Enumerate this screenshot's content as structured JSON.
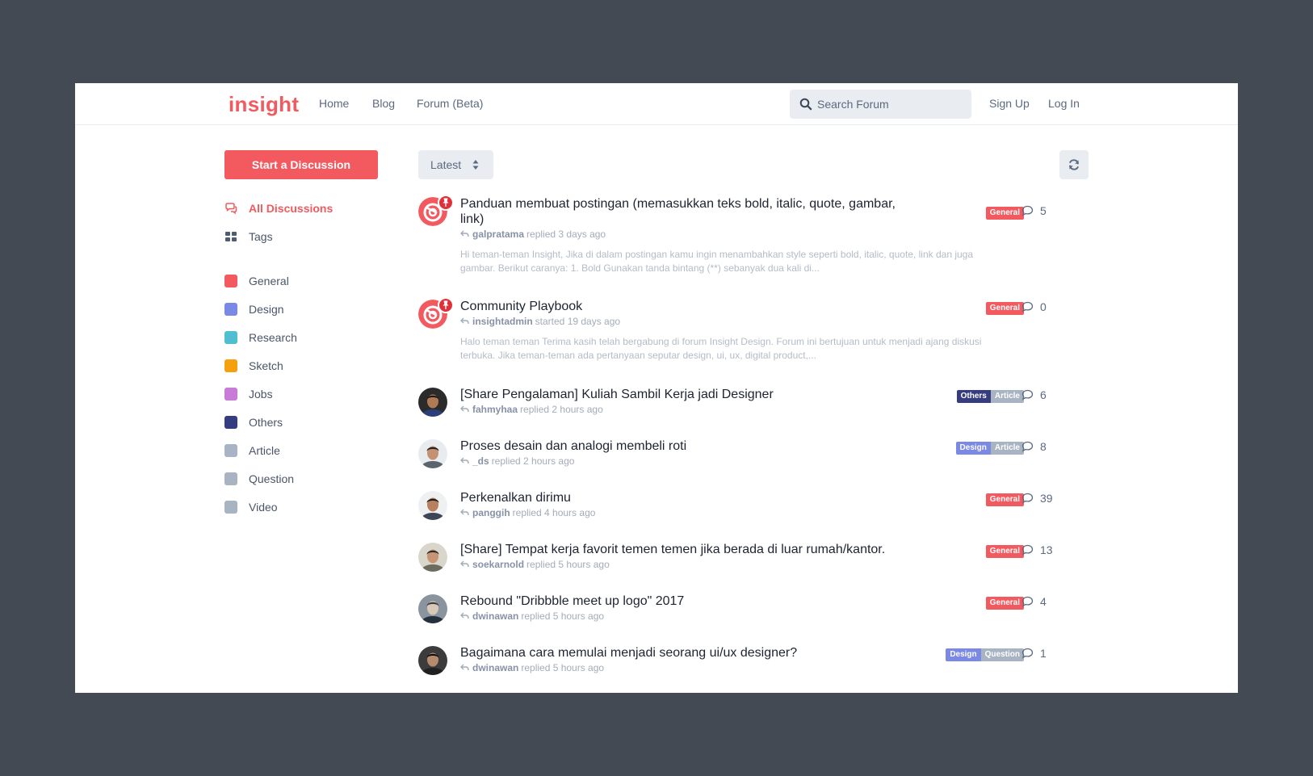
{
  "header": {
    "logo": "insight",
    "nav": [
      "Home",
      "Blog",
      "Forum (Beta)"
    ],
    "search_placeholder": "Search Forum",
    "signup": "Sign Up",
    "login": "Log In"
  },
  "sidebar": {
    "start_button": "Start a Discussion",
    "all_discussions": "All Discussions",
    "tags": "Tags",
    "categories": [
      {
        "label": "General",
        "color": "#f25a5f"
      },
      {
        "label": "Design",
        "color": "#7a88e6"
      },
      {
        "label": "Research",
        "color": "#4fbfcf"
      },
      {
        "label": "Sketch",
        "color": "#f5a00f"
      },
      {
        "label": "Jobs",
        "color": "#c77ad6"
      },
      {
        "label": "Others",
        "color": "#363c80"
      },
      {
        "label": "Article",
        "color": "#a9b4c2"
      },
      {
        "label": "Question",
        "color": "#a9b4c2"
      },
      {
        "label": "Video",
        "color": "#a9b4c2"
      }
    ]
  },
  "toolbar": {
    "sort": "Latest"
  },
  "discussions": [
    {
      "title": "Panduan membuat postingan (memasukkan teks bold, italic, quote, gambar, link)",
      "user": "galpratama",
      "action": "replied 3 days ago",
      "excerpt": "Hi teman-teman Insight, Jika di dalam postingan kamu ingin menambahkan style seperti bold, italic, quote, link dan juga gambar. Berikut caranya: 1. Bold Gunakan tanda bintang (**) sebanyak dua kali di...",
      "tags": [
        "General"
      ],
      "count": "5",
      "pinned": true
    },
    {
      "title": "Community Playbook",
      "user": "insightadmin",
      "action": "started 19 days ago",
      "excerpt": "Halo teman teman Terima kasih telah bergabung di forum Insight Design. Forum ini bertujuan untuk menjadi ajang diskusi terbuka. Jika teman-teman ada pertanyaan seputar design, ui, ux, digital product,...",
      "tags": [
        "General"
      ],
      "count": "0",
      "pinned": true
    },
    {
      "title": "[Share Pengalaman] Kuliah Sambil Kerja jadi Designer",
      "user": "fahmyhaa",
      "action": "replied 2 hours ago",
      "tags": [
        "Others",
        "Article"
      ],
      "count": "6"
    },
    {
      "title": "Proses desain dan analogi membeli roti",
      "user": "_ds",
      "action": "replied 2 hours ago",
      "tags": [
        "Design",
        "Article"
      ],
      "count": "8"
    },
    {
      "title": "Perkenalkan dirimu",
      "user": "panggih",
      "action": "replied 4 hours ago",
      "tags": [
        "General"
      ],
      "count": "39"
    },
    {
      "title": "[Share] Tempat kerja favorit temen temen jika berada di luar rumah/kantor.",
      "user": "soekarnold",
      "action": "replied 5 hours ago",
      "tags": [
        "General"
      ],
      "count": "13"
    },
    {
      "title": "Rebound \"Dribbble meet up logo\" 2017",
      "user": "dwinawan",
      "action": "replied 5 hours ago",
      "tags": [
        "General"
      ],
      "count": "4"
    },
    {
      "title": "Bagaimana cara memulai menjadi seorang ui/ux designer?",
      "user": "dwinawan",
      "action": "replied 5 hours ago",
      "tags": [
        "Design",
        "Question"
      ],
      "count": "1"
    }
  ]
}
